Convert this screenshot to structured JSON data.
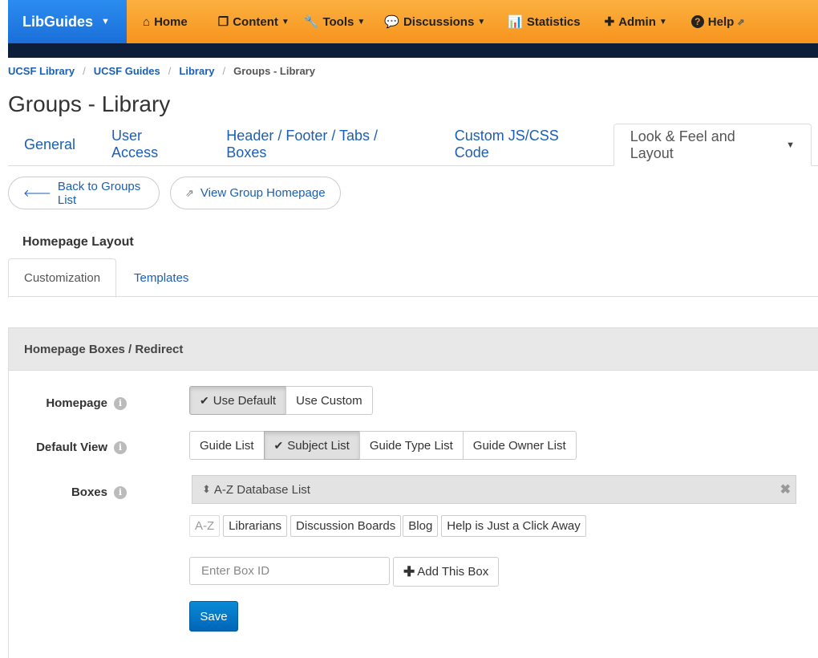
{
  "nav": {
    "brand": "LibGuides",
    "items": [
      {
        "label": "Home",
        "icon": "home-icon",
        "glyph": "⌂"
      },
      {
        "label": "Content",
        "icon": "content-icon",
        "glyph": "❐"
      },
      {
        "label": "Tools",
        "icon": "wrench-icon",
        "glyph": "🔧"
      },
      {
        "label": "Discussions",
        "icon": "comments-icon",
        "glyph": "💬"
      },
      {
        "label": "Statistics",
        "icon": "bar-chart-icon",
        "glyph": "📊"
      },
      {
        "label": "Admin",
        "icon": "puzzle-icon",
        "glyph": "✚"
      },
      {
        "label": "Help",
        "icon": "question-icon",
        "glyph": "?"
      }
    ]
  },
  "breadcrumb": [
    "UCSF Library",
    "UCSF Guides",
    "Library",
    "Groups - Library"
  ],
  "page_title": "Groups - Library",
  "main_tabs": [
    "General",
    "User Access",
    "Header / Footer / Tabs / Boxes",
    "Custom JS/CSS Code",
    "Look & Feel and Layout"
  ],
  "actions": {
    "back": "Back to Groups List",
    "view": "View Group Homepage"
  },
  "section_heading": "Homepage Layout",
  "sub_tabs": [
    "Customization",
    "Templates"
  ],
  "panel": {
    "heading": "Homepage Boxes / Redirect",
    "homepage_label": "Homepage",
    "homepage_options": [
      "Use Default",
      "Use Custom"
    ],
    "homepage_selected": "Use Default",
    "default_view_label": "Default View",
    "default_view_options": [
      "Guide List",
      "Subject List",
      "Guide Type List",
      "Guide Owner List"
    ],
    "default_view_selected": "Subject List",
    "boxes_label": "Boxes",
    "selected_box": "A-Z Database List",
    "available_boxes": [
      "A-Z",
      "Librarians",
      "Discussion Boards",
      "Blog",
      "Help is Just a Click Away"
    ],
    "box_id_placeholder": "Enter Box ID",
    "add_box": "Add This Box",
    "save": "Save"
  },
  "colors": {
    "nav_orange": "#f7941d",
    "brand_blue": "#1a6fd8",
    "link_blue": "#1a5fb4",
    "save_blue": "#0a7acb"
  }
}
